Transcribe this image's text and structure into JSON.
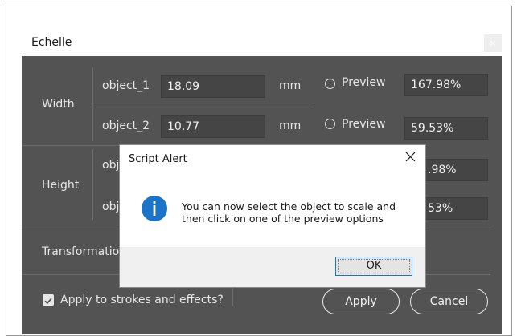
{
  "window": {
    "title": "Echelle",
    "close_glyph": "×"
  },
  "width_group": {
    "label": "Width",
    "rows": [
      {
        "object": "object_1",
        "value": "18.09",
        "unit": "mm",
        "preview_label": "Preview",
        "percent": "167.98%"
      },
      {
        "object": "object_2",
        "value": "10.77",
        "unit": "mm",
        "preview_label": "Preview",
        "percent": "59.53%"
      }
    ]
  },
  "height_group": {
    "label": "Height",
    "rows": [
      {
        "object_partial": "obj",
        "percent_partial": ".98%"
      },
      {
        "object_partial": "obj",
        "percent_partial": "53%"
      }
    ]
  },
  "transformation_label": "Transformatio",
  "checkbox": {
    "label": "Apply to strokes and effects?",
    "checked": true
  },
  "buttons": {
    "apply": "Apply",
    "cancel": "Cancel"
  },
  "alert": {
    "title": "Script Alert",
    "icon": "info-icon",
    "message_line1": "You can now select the object to scale and",
    "message_line2": "then click on one of the preview options",
    "ok": "OK"
  },
  "colors": {
    "panel": "#535353",
    "field": "#454545",
    "info_blue": "#1a74c7"
  }
}
